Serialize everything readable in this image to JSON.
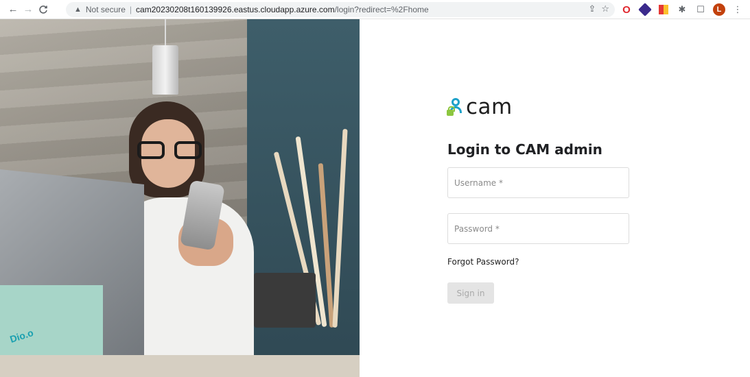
{
  "browser": {
    "back_icon": "←",
    "forward_icon": "→",
    "reload_icon": "C",
    "security_warning": "Not secure",
    "url_host": "cam20230208t160139926.eastus.cloudapp.azure.com",
    "url_path": "/login?redirect=%2Fhome",
    "avatar_letter": "L"
  },
  "photo": {
    "notebook_logo": "Dio.o"
  },
  "login": {
    "brand_name": "cam",
    "title": "Login to CAM admin",
    "username_placeholder": "Username *",
    "password_placeholder": "Password *",
    "forgot_label": "Forgot Password?",
    "signin_label": "Sign in"
  },
  "colors": {
    "brand_blue": "#1da1c9",
    "brand_green": "#8cc63f",
    "signin_disabled_bg": "#e4e4e4",
    "signin_disabled_text": "#a9a9a9"
  }
}
